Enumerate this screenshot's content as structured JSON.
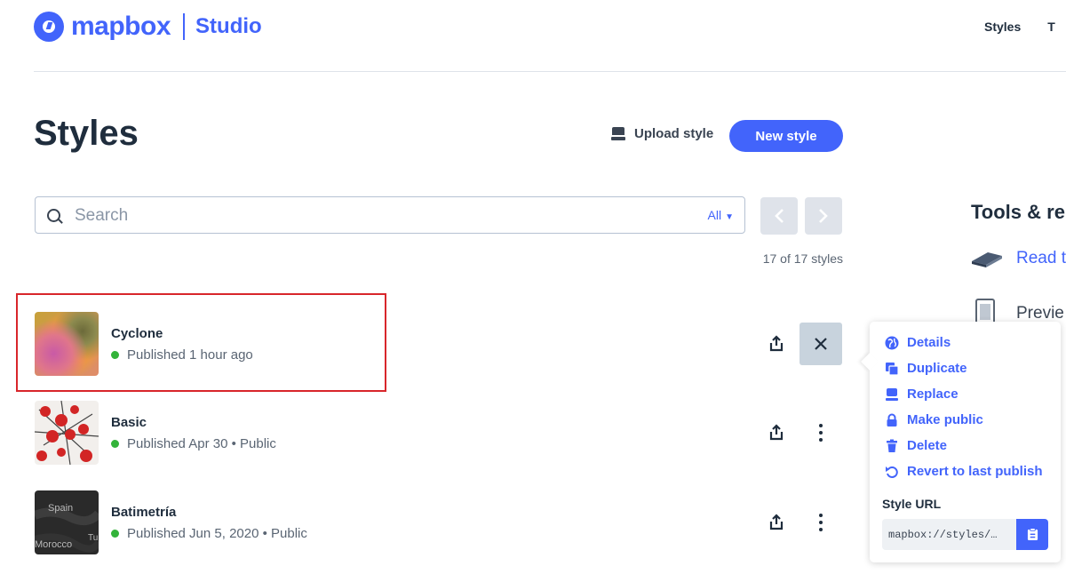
{
  "header": {
    "brand": "mapbox",
    "product": "Studio",
    "nav": [
      "Styles",
      "T"
    ]
  },
  "page": {
    "title": "Styles",
    "upload_label": "Upload style",
    "new_style_label": "New style"
  },
  "search": {
    "placeholder": "Search",
    "filter_label": "All",
    "count_text": "17 of 17 styles"
  },
  "styles": [
    {
      "name": "Cyclone",
      "status": "Published 1 hour ago"
    },
    {
      "name": "Basic",
      "status": "Published Apr 30 • Public"
    },
    {
      "name": "Batimetría",
      "status": "Published Jun 5, 2020 • Public"
    }
  ],
  "thumb_labels": {
    "spain": "Spain",
    "morocco": "Morocco",
    "tu": "Tu"
  },
  "sidebar": {
    "title": "Tools & re",
    "link": "Read t",
    "preview": "Previe"
  },
  "menu": {
    "items": [
      "Details",
      "Duplicate",
      "Replace",
      "Make public",
      "Delete",
      "Revert to last publish"
    ],
    "url_label": "Style URL",
    "url_value": "mapbox://styles/…"
  },
  "colors": {
    "accent": "#4264fb",
    "published": "#33b33a",
    "highlight": "#d8262b"
  }
}
